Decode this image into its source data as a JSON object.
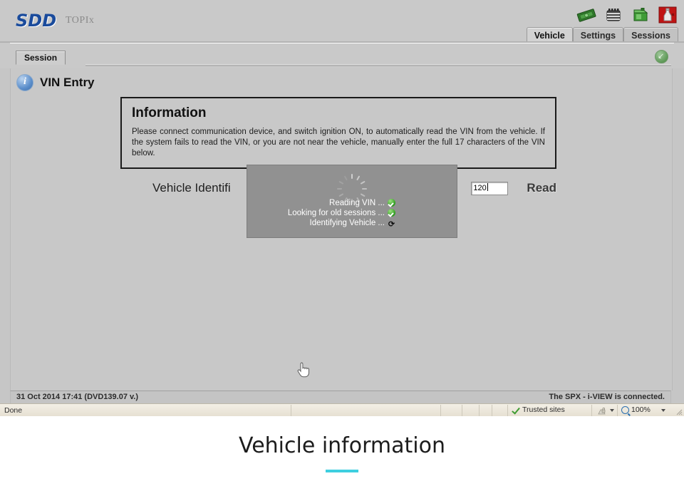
{
  "app": {
    "brand": "SDD",
    "brand_sub": "TOPIx",
    "accent_color": "#1a4b9c"
  },
  "topbar": {
    "icons": [
      {
        "name": "money-icon",
        "label": "Money"
      },
      {
        "name": "battery-icon",
        "label": "Battery"
      },
      {
        "name": "fuel-can-icon",
        "label": "Fuel can"
      },
      {
        "name": "fluid-bottle-icon",
        "label": "Fluid bottle"
      }
    ],
    "tabs": [
      {
        "label": "Vehicle",
        "active": true
      },
      {
        "label": "Settings",
        "active": false
      },
      {
        "label": "Sessions",
        "active": false
      }
    ]
  },
  "sessionbar": {
    "tab_label": "Session",
    "collapse_icon": "collapse-arrow-icon",
    "collapse_glyph": "↙"
  },
  "page": {
    "title": "VIN Entry",
    "title_icon": "info-icon",
    "title_icon_glyph": "i"
  },
  "information": {
    "heading": "Information",
    "body": "Please connect communication device, and switch ignition ON, to automatically read the VIN from the vehicle. If the system fails to read the VIN, or you are not near the vehicle, manually enter the full 17 characters of the VIN below."
  },
  "vin_row": {
    "label": "Vehicle Identifi",
    "input_value": "120",
    "input_placeholder": "",
    "read_label": "Read"
  },
  "modal": {
    "spinner_name": "loading-spinner",
    "lines": [
      {
        "text": "Reading VIN ...",
        "status": "done",
        "icon": "check-icon"
      },
      {
        "text": "Looking for old sessions ...",
        "status": "done",
        "icon": "check-icon"
      },
      {
        "text": "Identifying Vehicle ...",
        "status": "busy",
        "icon": "refresh-icon",
        "glyph": "⟳"
      }
    ]
  },
  "app_status": {
    "left": "31 Oct 2014 17:41 (DVD139.07 v.)",
    "right": "The SPX - i-VIEW is connected."
  },
  "ie_status": {
    "done": "Done",
    "zone": "Trusted sites",
    "zone_icon": "check-icon",
    "lock_icon": "lock-icon",
    "zoom_icon": "magnifier-icon",
    "zoom": "100%",
    "dropdown_icon": "chevron-down-icon",
    "grip_icon": "resize-grip-icon"
  },
  "caption": {
    "text": "Vehicle information",
    "underline_color": "#3ecfe0"
  }
}
